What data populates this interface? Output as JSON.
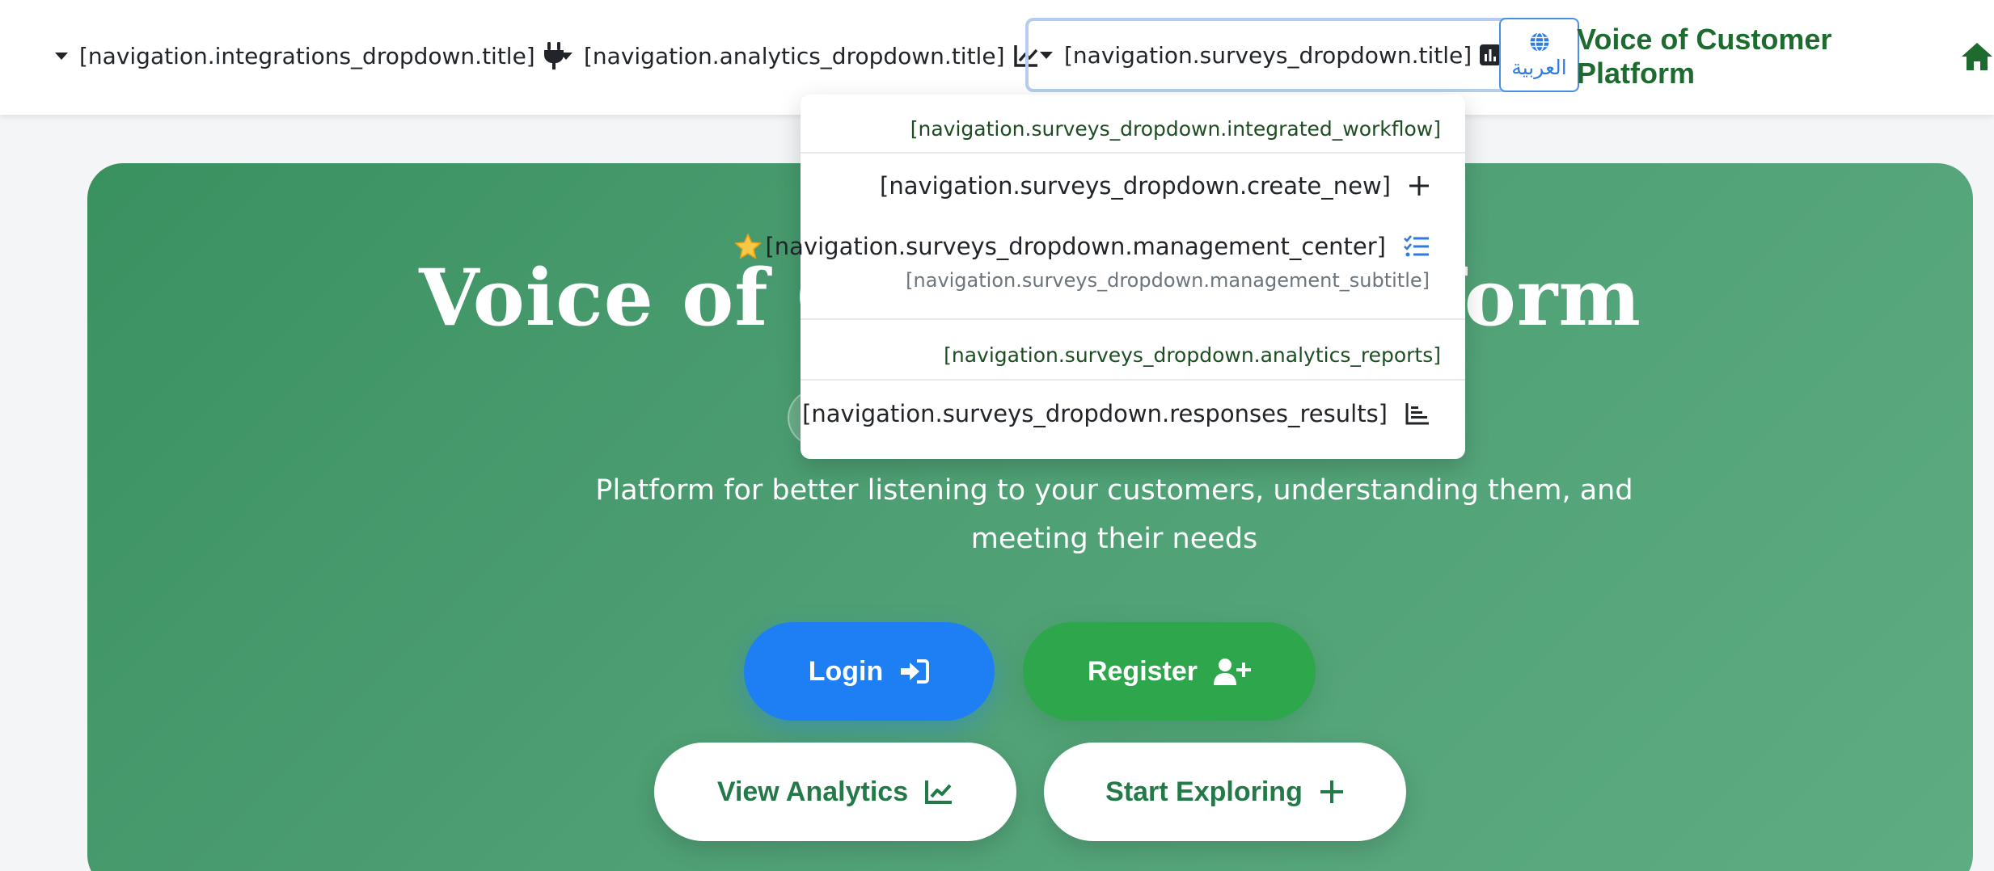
{
  "nav": {
    "integrations_dropdown_title": "[navigation.integrations_dropdown.title]",
    "analytics_dropdown_title": "[navigation.analytics_dropdown.title]",
    "surveys_dropdown_title": "[navigation.surveys_dropdown.title]",
    "language_label": "العربية",
    "brand_name": "Voice of Customer Platform"
  },
  "surveys_menu": {
    "integrated_workflow": "[navigation.surveys_dropdown.integrated_workflow]",
    "create_new": "[navigation.surveys_dropdown.create_new]",
    "management_center": "[navigation.surveys_dropdown.management_center]",
    "management_subtitle": "[navigation.surveys_dropdown.management_subtitle]",
    "analytics_reports": "[navigation.surveys_dropdown.analytics_reports]",
    "responses_results": "[navigation.surveys_dropdown.responses_results]"
  },
  "hero": {
    "title": "Voice of Customer Platform",
    "subtitle": "Platform for better listening to your customers, understanding them, and meeting their needs",
    "buttons": {
      "login": "Login",
      "register": "Register",
      "view_analytics": "View Analytics",
      "start_exploring": "Start Exploring"
    }
  },
  "icons": {
    "integrations": "plug-icon",
    "analytics": "chart-line-icon",
    "surveys": "poll-icon",
    "language": "globe-icon",
    "home": "home-icon",
    "create": "plus-icon",
    "management": "tasks-icon",
    "favorite": "star-icon",
    "responses": "bar-chart-icon",
    "login": "sign-in-icon",
    "register": "user-plus-icon"
  },
  "colors": {
    "brand_green": "#1e6b2f",
    "hero_green": "#3a9160",
    "login_blue": "#1d7ff3",
    "register_green": "#2ea64b",
    "accent_blue": "#2f7be2"
  }
}
